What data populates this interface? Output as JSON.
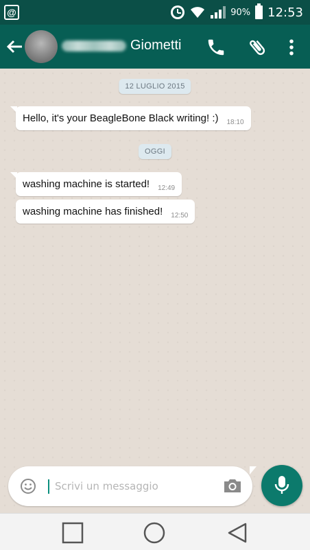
{
  "status_bar": {
    "notification_icon": "@",
    "battery_percent": "90%",
    "time": "12:53",
    "icons": [
      "at-notification-icon",
      "alarm-icon",
      "wifi-icon",
      "signal-icon",
      "battery-icon"
    ]
  },
  "header": {
    "contact_name": "Giometti",
    "icons": [
      "back-arrow-icon",
      "avatar",
      "phone-icon",
      "paperclip-icon",
      "more-vert-icon"
    ]
  },
  "chat": {
    "date_chip_1": "12 LUGLIO 2015",
    "date_chip_2": "OGGI",
    "messages": [
      {
        "text": "Hello, it's your BeagleBone Black writing! :)",
        "time": "18:10"
      },
      {
        "text": "washing machine is started!",
        "time": "12:49"
      },
      {
        "text": "washing machine has finished!",
        "time": "12:50"
      }
    ]
  },
  "composer": {
    "placeholder": "Scrivi un messaggio",
    "icons": [
      "emoji-icon",
      "camera-icon",
      "mic-icon"
    ]
  },
  "nav_bar": {
    "icons": [
      "recents-square-icon",
      "home-circle-icon",
      "back-triangle-icon"
    ]
  },
  "colors": {
    "status_bar": "#0b4f47",
    "app_bar": "#075e54",
    "chat_background": "#e5ddd5",
    "accent": "#0c7a6c"
  }
}
